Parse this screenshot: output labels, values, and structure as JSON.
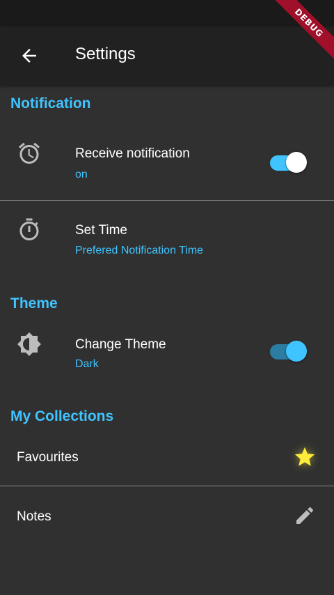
{
  "app_bar": {
    "title": "Settings",
    "debug_label": "DEBUG"
  },
  "sections": {
    "notification": {
      "header": "Notification",
      "receive": {
        "title": "Receive notification",
        "subtitle": "on",
        "enabled": true
      },
      "set_time": {
        "title": "Set Time",
        "subtitle": "Prefered Notification Time"
      }
    },
    "theme": {
      "header": "Theme",
      "change_theme": {
        "title": "Change Theme",
        "subtitle": "Dark",
        "enabled": true
      }
    },
    "collections": {
      "header": "My Collections",
      "favourites": {
        "title": "Favourites",
        "icon": "star-icon"
      },
      "notes": {
        "title": "Notes",
        "icon": "pencil-icon"
      }
    }
  },
  "colors": {
    "accent": "#40c4ff",
    "background": "#303030",
    "app_bar": "#212121",
    "star": "#ffeb3b"
  }
}
